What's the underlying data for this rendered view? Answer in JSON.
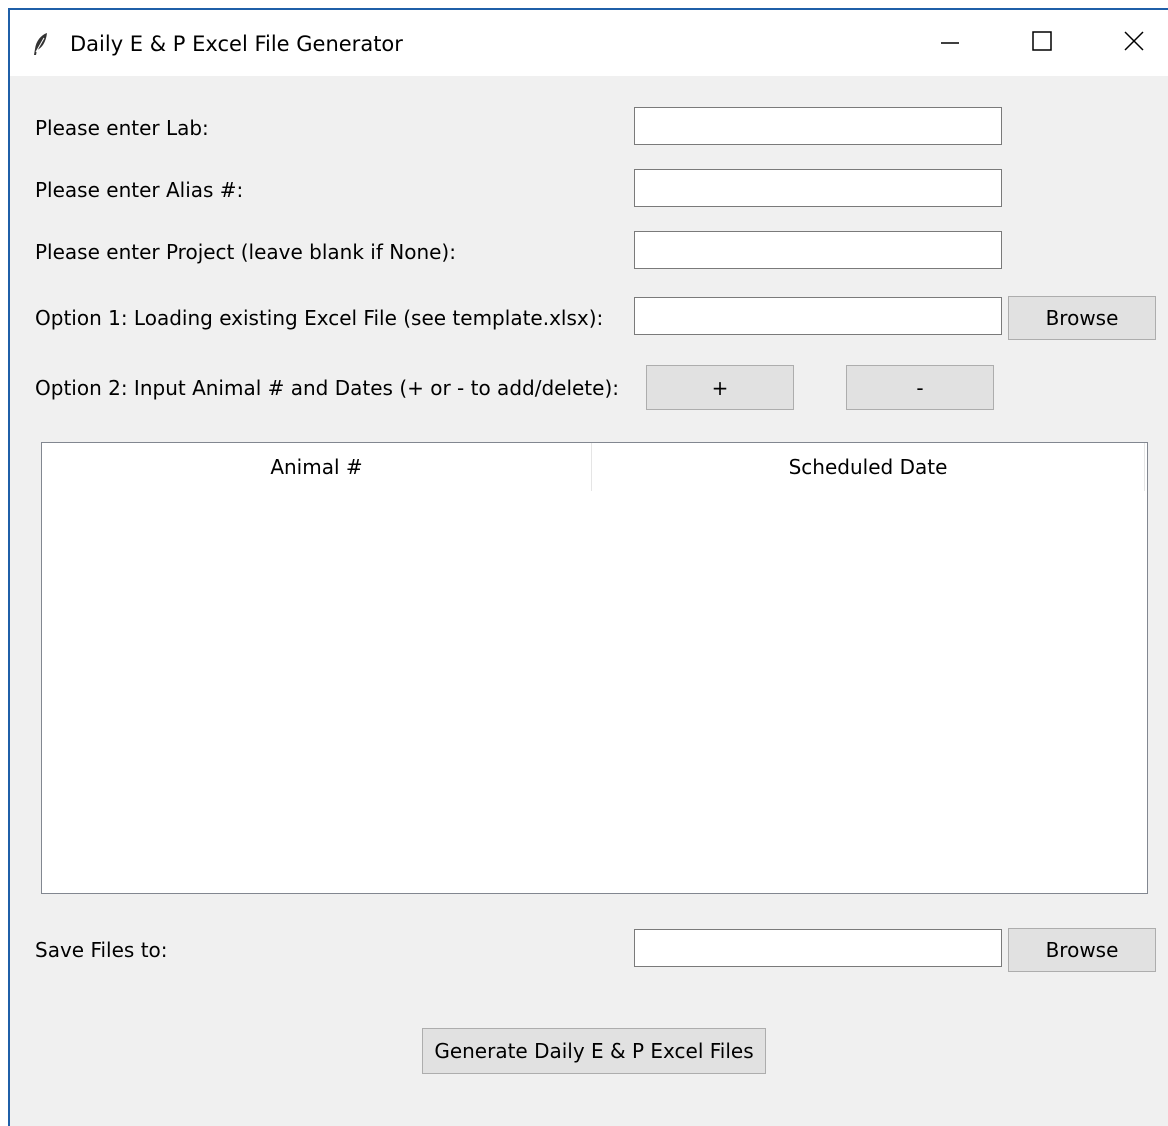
{
  "window": {
    "title": "Daily E & P Excel File Generator"
  },
  "form": {
    "lab_label": "Please enter Lab:",
    "lab_value": "",
    "alias_label": "Please enter Alias #:",
    "alias_value": "",
    "project_label": "Please enter Project (leave blank if None):",
    "project_value": "",
    "option1_label": "Option 1: Loading existing Excel File (see template.xlsx):",
    "option1_value": "",
    "option1_browse": "Browse",
    "option2_label": "Option 2: Input Animal # and Dates (+ or - to add/delete):",
    "add_label": "+",
    "delete_label": "-"
  },
  "table": {
    "columns": [
      "Animal #",
      "Scheduled Date"
    ],
    "rows": []
  },
  "save": {
    "label": "Save Files to:",
    "value": "",
    "browse": "Browse"
  },
  "generate_label": "Generate Daily E & P Excel Files",
  "icons": {
    "app": "feather-icon",
    "minimize": "minimize-icon",
    "maximize": "maximize-icon",
    "close": "close-icon"
  }
}
